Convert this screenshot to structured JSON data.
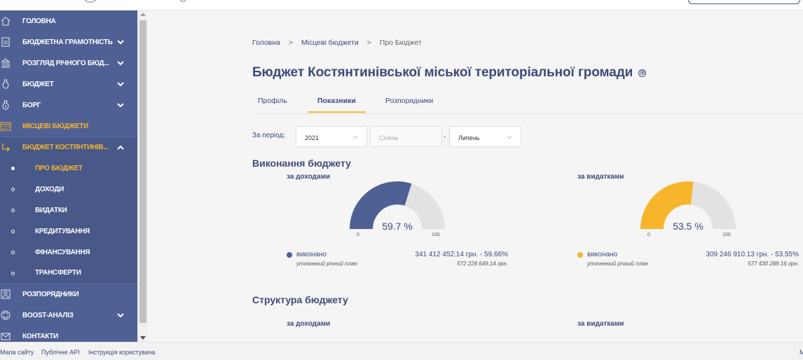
{
  "sidebar": {
    "items": [
      {
        "label": "ГОЛОВНА",
        "icon": "home-icon"
      },
      {
        "label": "БЮДЖЕТНА ГРАМОТНІСТЬ",
        "icon": "document-icon"
      },
      {
        "label": "РОЗГЛЯД РІЧНОГО БЮД...",
        "icon": "building-icon"
      },
      {
        "label": "БЮДЖЕТ",
        "icon": "money-bag-icon"
      },
      {
        "label": "БОРГ",
        "icon": "debt-icon"
      },
      {
        "label": "МІСЦЕВІ БЮДЖЕТИ",
        "icon": "calendar-icon"
      },
      {
        "label": "БЮДЖЕТ КОСТЯНТИНІВ...",
        "icon": "arrow-return-icon"
      }
    ],
    "sub_items": [
      {
        "label": "ПРО БЮДЖЕТ"
      },
      {
        "label": "ДОХОДИ"
      },
      {
        "label": "ВИДАТКИ"
      },
      {
        "label": "КРЕДИТУВАННЯ"
      },
      {
        "label": "ФІНАНСУВАННЯ"
      },
      {
        "label": "ТРАНСФЕРТИ"
      }
    ],
    "bottom_items": [
      {
        "label": "РОЗПОРЯДНИКИ",
        "icon": "managers-icon"
      },
      {
        "label": "BOOST-АНАЛІЗ",
        "icon": "refresh-icon"
      },
      {
        "label": "КОНТАКТИ",
        "icon": "mail-icon"
      }
    ]
  },
  "breadcrumb": {
    "home": "Головна",
    "sep": ">",
    "local": "Місцеві бюджети",
    "current": "Про Бюджет"
  },
  "page": {
    "title": "Бюджет Костянтинівської міської територіальної громади",
    "title_icon": "⊕"
  },
  "tabs": {
    "profile": "Профіль",
    "indicators": "Показники",
    "managers": "Розпорядники"
  },
  "period": {
    "label": "За період:",
    "year": "2021",
    "from_month": "Січень",
    "dash": "-",
    "to_month": "Липень"
  },
  "execution": {
    "title": "Виконання бюджету",
    "revenue": {
      "heading": "за доходами",
      "percent_label": "59.7 %",
      "tick_min": "0",
      "tick_max": "100",
      "legend_done": "виконано",
      "legend_plan": "уточнений річний план",
      "done_value": "341 412 452.14 грн. - 59.66%",
      "plan_value": "572 228 649.14 грн."
    },
    "expenses": {
      "heading": "за видатками",
      "percent_label": "53.5 %",
      "tick_min": "0",
      "tick_max": "100",
      "legend_done": "виконано",
      "legend_plan": "уточнений річний план",
      "done_value": "309 246 910.13 грн. - 53.55%",
      "plan_value": "577 430 288.16 грн."
    }
  },
  "structure": {
    "title": "Структура бюджету",
    "revenue_heading": "за доходами",
    "expenses_heading": "за видатками"
  },
  "chart_data": [
    {
      "type": "gauge",
      "title": "за доходами",
      "value": 59.7,
      "range": [
        0,
        100
      ],
      "color": "#4f6094",
      "track_color": "#e2e2e2"
    },
    {
      "type": "gauge",
      "title": "за видатками",
      "value": 53.5,
      "range": [
        0,
        100
      ],
      "color": "#f7b52c",
      "track_color": "#e2e2e2"
    }
  ],
  "footer": {
    "sitemap": "Мапа сайту",
    "api": "Публічне API",
    "manual": "Інструкція користувача",
    "right_char": "М"
  },
  "colors": {
    "sidebar": "#4f6094",
    "accent": "#f7b52c",
    "primary_text": "#3d4a7a"
  }
}
